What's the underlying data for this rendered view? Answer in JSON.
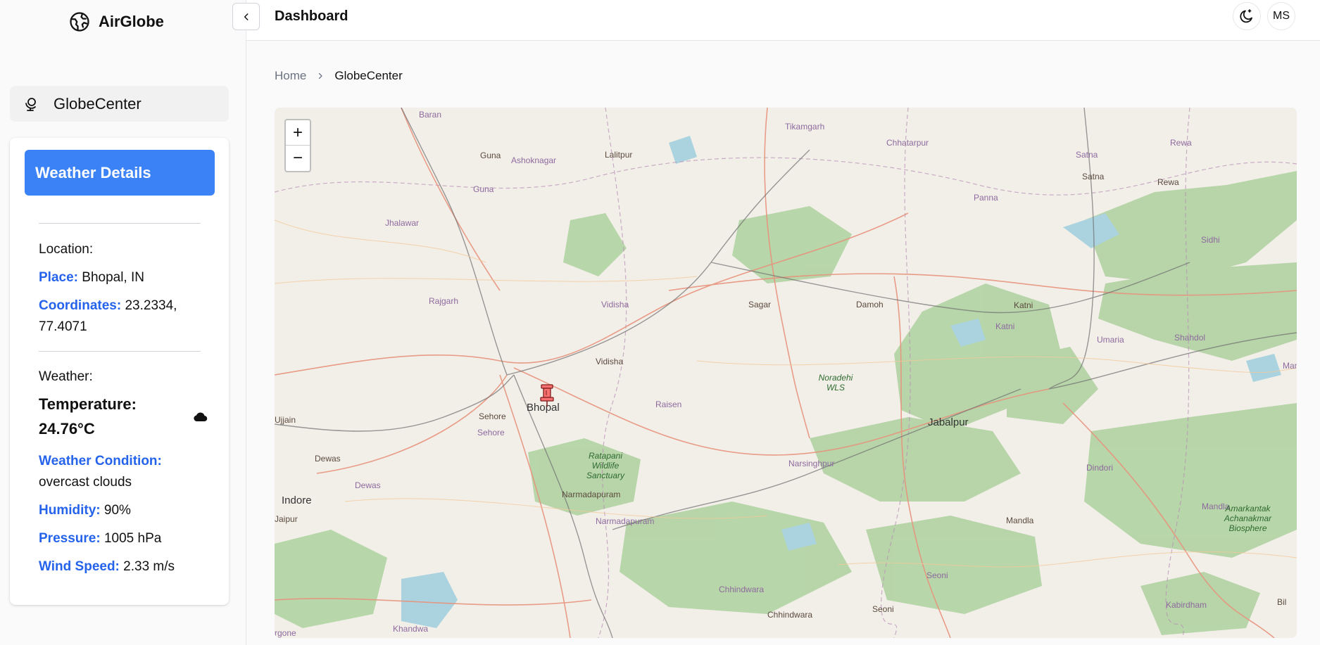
{
  "app": {
    "name": "AirGlobe"
  },
  "sidebar": {
    "nav_items": [
      {
        "label": "GlobeCenter",
        "icon": "globe-stand-icon"
      }
    ]
  },
  "weather": {
    "button_label": "Weather Details",
    "location_heading": "Location:",
    "place_key": "Place:",
    "place_value": "Bhopal, IN",
    "coordinates_key": "Coordinates:",
    "coordinates_value": "23.2334, 77.4071",
    "weather_heading": "Weather:",
    "temperature_key": "Temperature:",
    "temperature_value": "24.76°C",
    "condition_icon": "cloud-icon",
    "condition_key": "Weather Condition:",
    "condition_value": "overcast clouds",
    "humidity_key": "Humidity:",
    "humidity_value": "90%",
    "pressure_key": "Pressure:",
    "pressure_value": "1005 hPa",
    "wind_key": "Wind Speed:",
    "wind_value": "2.33 m/s"
  },
  "header": {
    "title": "Dashboard",
    "avatar_initials": "MS"
  },
  "breadcrumb": {
    "home": "Home",
    "current": "GlobeCenter"
  },
  "map": {
    "zoom_in": "+",
    "zoom_out": "−",
    "marker": "Bhopal",
    "places": {
      "baran": "Baran",
      "guna": "Guna",
      "guna2": "Guna",
      "ashoknagar": "Ashoknagar",
      "lalitpur": "Lalitpur",
      "tikamgarh": "Tikamgarh",
      "chhatarpur": "Chhatarpur",
      "satna": "Satna",
      "satna2": "Satna",
      "rewa": "Rewa",
      "rewa2": "Rewa",
      "panna": "Panna",
      "sidhi": "Sidhi",
      "jhalawar": "Jhalawar",
      "rajgarh": "Rajgarh",
      "vidisha": "Vidisha",
      "vidisha2": "Vidisha",
      "sagar": "Sagar",
      "damoh": "Damoh",
      "katni": "Katni",
      "katni2": "Katni",
      "umaria": "Umaria",
      "shahdol": "Shahdol",
      "noradehi": "Noradehi WLS",
      "ujjain": "Ujjain",
      "sehore": "Sehore",
      "sehore2": "Sehore",
      "bhopal": "Bhopal",
      "raisen": "Raisen",
      "jabalpur": "Jabalpur",
      "dewas": "Dewas",
      "dewas2": "Dewas",
      "ratapani": "Ratapani Wildlife Sanctuary",
      "narsinghpur": "Narsinghpur",
      "dindori": "Dindori",
      "indore": "Indore",
      "narmadapuram": "Narmadapuram",
      "narmadapuram2": "Narmadapuram",
      "mandla": "Mandla",
      "mandla2": "Mandla",
      "amarkantak": "Amarkantak Achanakmar Biosphere",
      "chhindwara": "Chhindwara",
      "chhindwara2": "Chhindwara",
      "seoni": "Seoni",
      "seoni2": "Seoni",
      "kabirdham": "Kabirdham",
      "khandwa": "Khandwa",
      "bilaspur": "Bil",
      "jaipur": "Jaipur",
      "khargone": "rgone",
      "mandi": "Mand"
    }
  }
}
